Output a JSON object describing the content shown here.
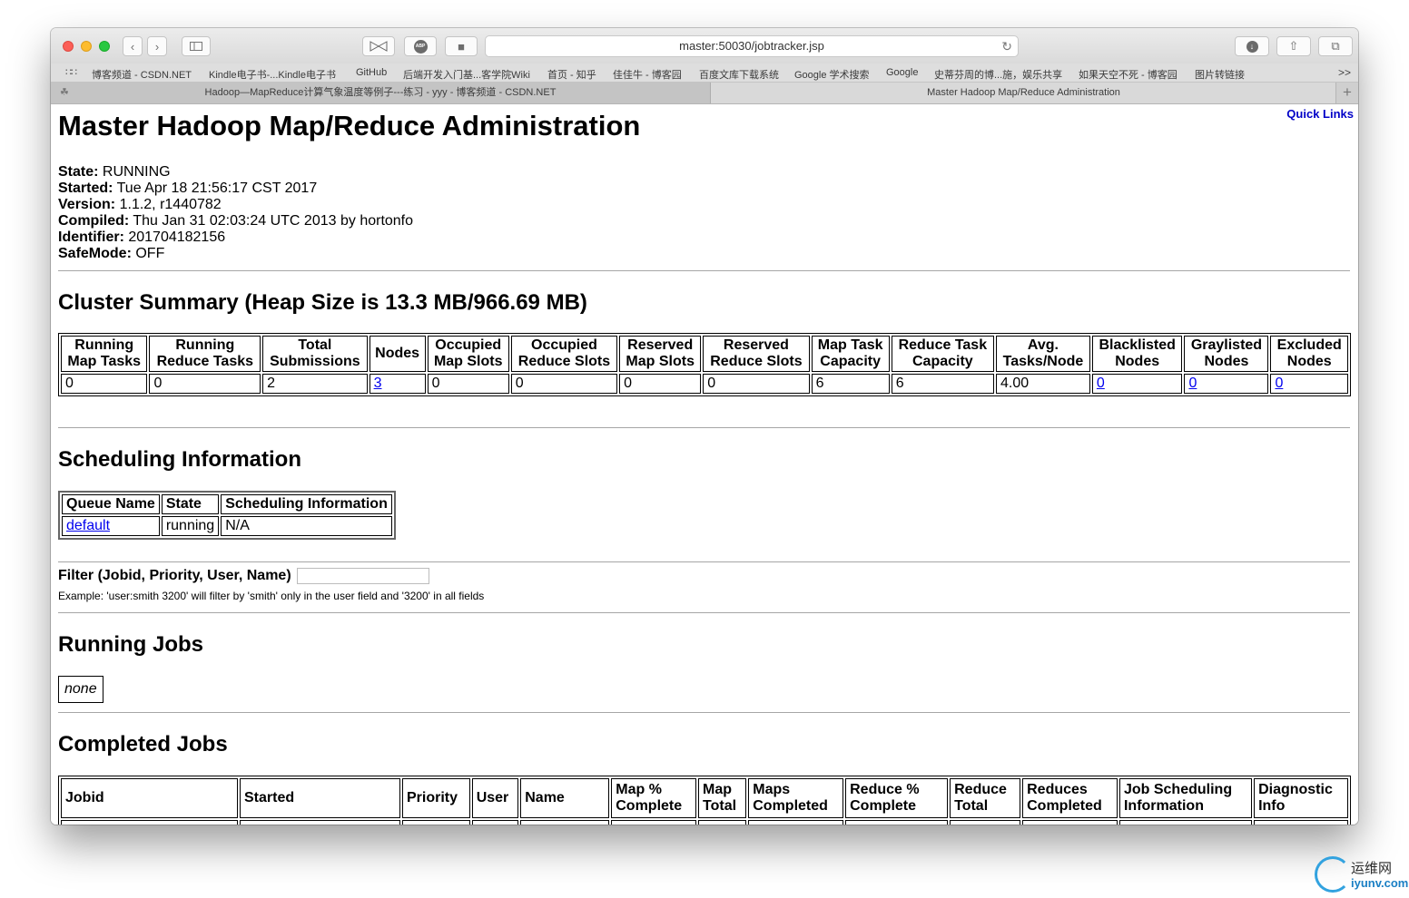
{
  "browser": {
    "url": "master:50030/jobtracker.jsp",
    "adblock_label": "ABP",
    "favorites_more": ">>",
    "favorites": [
      "博客频道 - CSDN.NET",
      "Kindle电子书-...Kindle电子书",
      "GitHub",
      "后端开发入门基...客学院Wiki",
      "首页 - 知乎",
      "佳佳牛 - 博客园",
      "百度文库下载系统",
      "Google 学术搜索",
      "Google",
      "史蒂芬周的博...施，娱乐共享",
      "如果天空不死 - 博客园",
      "图片转链接"
    ],
    "tabs": [
      "Hadoop—MapReduce计算气象温度等例子---练习 - yyy - 博客频道 - CSDN.NET",
      "Master Hadoop Map/Reduce Administration"
    ],
    "tab_plus": "+"
  },
  "page": {
    "quick_links": "Quick Links",
    "title": "Master Hadoop Map/Reduce Administration",
    "info": [
      {
        "label": "State:",
        "value": "RUNNING"
      },
      {
        "label": "Started:",
        "value": "Tue Apr 18 21:56:17 CST 2017"
      },
      {
        "label": "Version:",
        "value": "1.1.2, r1440782"
      },
      {
        "label": "Compiled:",
        "value": "Thu Jan 31 02:03:24 UTC 2013 by hortonfo"
      },
      {
        "label": "Identifier:",
        "value": "201704182156"
      },
      {
        "label": "SafeMode:",
        "value": "OFF"
      }
    ],
    "cluster_summary": {
      "heading": "Cluster Summary (Heap Size is 13.3 MB/966.69 MB)",
      "headers": [
        [
          "Running",
          "Map Tasks"
        ],
        [
          "Running",
          "Reduce Tasks"
        ],
        [
          "Total",
          "Submissions"
        ],
        [
          "Nodes",
          ""
        ],
        [
          "Occupied",
          "Map Slots"
        ],
        [
          "Occupied",
          "Reduce Slots"
        ],
        [
          "Reserved",
          "Map Slots"
        ],
        [
          "Reserved",
          "Reduce Slots"
        ],
        [
          "Map Task",
          "Capacity"
        ],
        [
          "Reduce Task",
          "Capacity"
        ],
        [
          "Avg.",
          "Tasks/Node"
        ],
        [
          "Blacklisted",
          "Nodes"
        ],
        [
          "Graylisted",
          "Nodes"
        ],
        [
          "Excluded",
          "Nodes"
        ]
      ],
      "values": [
        "0",
        "0",
        "2",
        "3",
        "0",
        "0",
        "0",
        "0",
        "6",
        "6",
        "4.00",
        "0",
        "0",
        "0"
      ]
    },
    "scheduling": {
      "heading": "Scheduling Information",
      "headers": [
        "Queue Name",
        "State",
        "Scheduling Information"
      ],
      "row": [
        "default",
        "running",
        "N/A"
      ]
    },
    "filter": {
      "label": "Filter (Jobid, Priority, User, Name)",
      "value": "",
      "example": "Example: 'user:smith 3200' will filter by 'smith' only in the user field and '3200' in all fields"
    },
    "running_jobs": {
      "heading": "Running Jobs",
      "empty": "none"
    },
    "completed_jobs": {
      "heading": "Completed Jobs",
      "headers": [
        [
          "Jobid",
          ""
        ],
        [
          "Started",
          ""
        ],
        [
          "Priority",
          ""
        ],
        [
          "User",
          ""
        ],
        [
          "Name",
          ""
        ],
        [
          "Map %",
          "Complete"
        ],
        [
          "Map",
          "Total"
        ],
        [
          "Maps",
          "Completed"
        ],
        [
          "Reduce %",
          "Complete"
        ],
        [
          "Reduce",
          "Total"
        ],
        [
          "Reduces",
          "Completed"
        ],
        [
          "Job Scheduling",
          "Information"
        ],
        [
          "Diagnostic",
          "Info"
        ]
      ]
    }
  },
  "watermark": {
    "line1": "运维网",
    "line2": "iyunv.com"
  }
}
